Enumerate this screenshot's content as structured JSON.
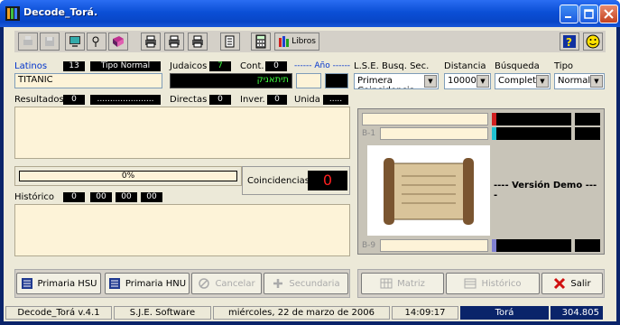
{
  "window": {
    "title": "Decode_Torá."
  },
  "toolbar": {
    "libros_label": "Libros"
  },
  "search": {
    "latinos_label": "Latinos",
    "latinos_count": "13",
    "tipo_label": "Tipo Normal",
    "latinos_value": "TITANIC",
    "judaicos_label": "Judaicos",
    "judaicos_count": "7",
    "cont_label": "Cont.",
    "cont_value": "0",
    "ano_label": "------ Año ------",
    "judaicos_value": "תיתאניק"
  },
  "options": {
    "lse_label": "L.S.E. Busq. Sec.",
    "lse_value": "Primera Coincidencia",
    "distancia_label": "Distancia",
    "distancia_value": "10000",
    "busqueda_label": "Búsqueda",
    "busqueda_value": "Completa",
    "tipo_label": "Tipo",
    "tipo_value": "Normal"
  },
  "results": {
    "resultados_label": "Resultados",
    "resultados_value": "0",
    "resultados_dots": "......................",
    "directas_label": "Directas",
    "directas_value": "0",
    "inver_label": "Inver.",
    "inver_value": "0",
    "unida_label": "Unida",
    "unida_value": "....."
  },
  "progress": {
    "label": "0%",
    "fraction": 0
  },
  "coincidencias": {
    "label": "Coincidencias",
    "value": "0"
  },
  "historico": {
    "label": "Histórico",
    "v1": "0",
    "v2": "00",
    "v3": "00",
    "v4": "00"
  },
  "matrix": {
    "row_top": "B-1",
    "row_bottom": "B-9",
    "demo_text": "---- Versión Demo ----"
  },
  "buttons": {
    "primaria_hsu": "Primaria HSU",
    "primaria_hnu": "Primaria HNU",
    "cancelar": "Cancelar",
    "secundaria": "Secundaria",
    "matriz": "Matriz",
    "historico": "Histórico",
    "salir": "Salir"
  },
  "status": {
    "app": "Decode_Torá  v.4.1",
    "company": "S.J.E. Software",
    "date": "miércoles, 22 de marzo de 2006",
    "time": "14:09:17",
    "torah": "Torá",
    "number": "304.805"
  },
  "colors": {
    "title_blue": "#0b4fd6",
    "panel_cream": "#fdf3d8",
    "coinc_red": "#ff2020"
  }
}
